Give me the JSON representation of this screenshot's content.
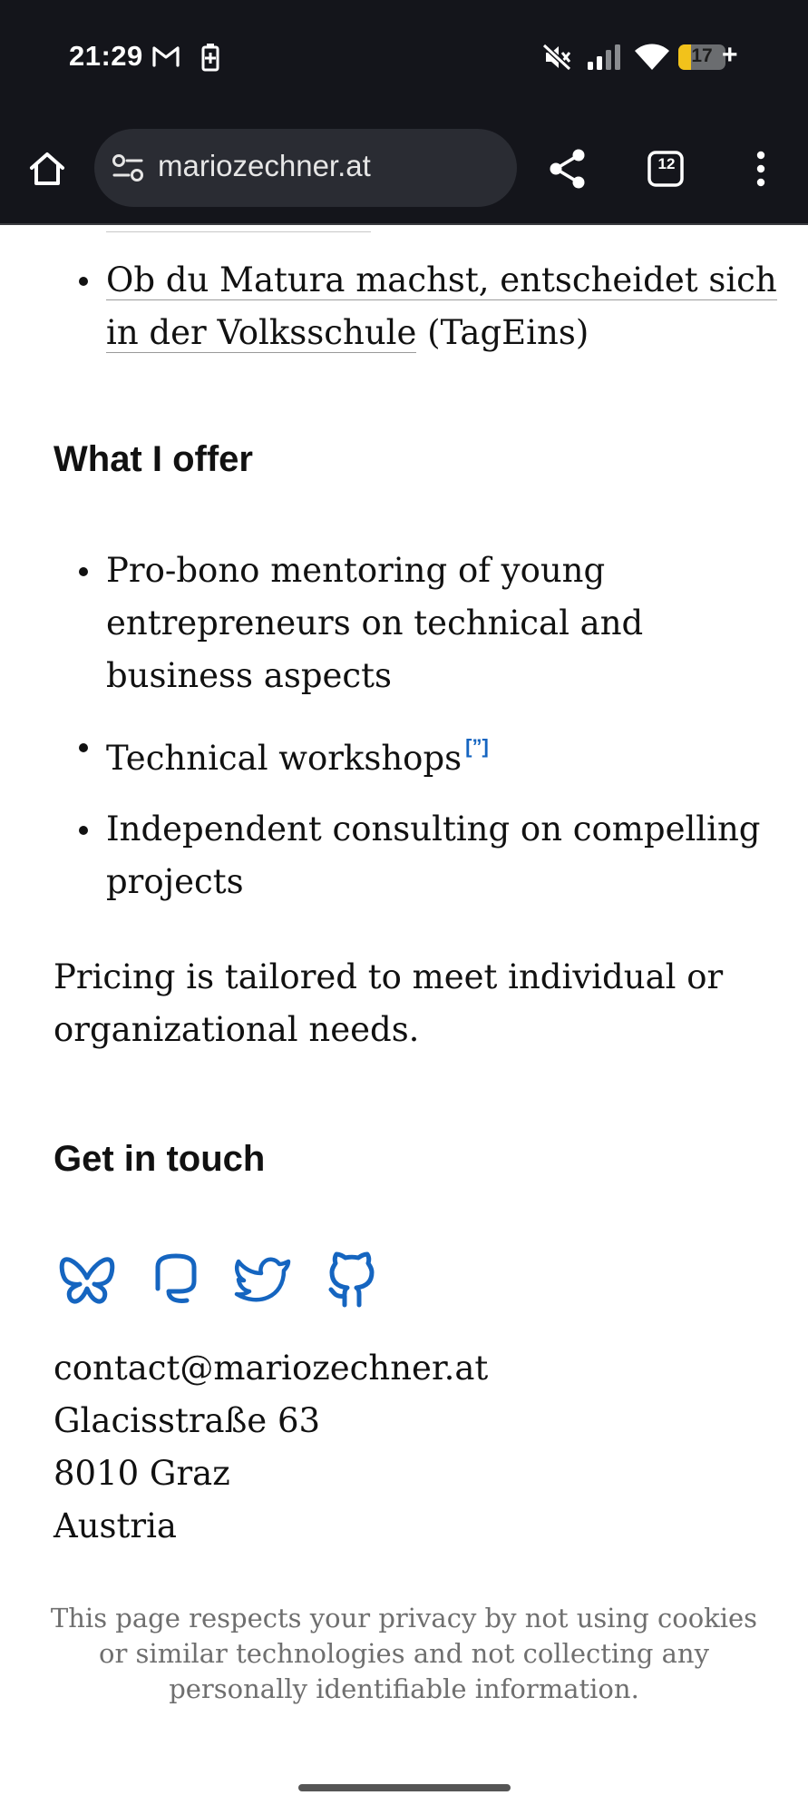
{
  "status_bar": {
    "time": "21:29",
    "notification_icons": [
      "gmail-icon",
      "battery-saver-icon"
    ],
    "system_icons": [
      "mute-icon",
      "signal-icon",
      "wifi-icon"
    ],
    "battery_level": "17",
    "battery_charging": "+"
  },
  "browser": {
    "url": "mariozechner.at",
    "tab_count": "12",
    "icons": [
      "home-icon",
      "site-settings-icon",
      "share-icon",
      "tabs-icon",
      "more-menu-icon"
    ]
  },
  "content": {
    "prev_list": {
      "link_text": "Ob du Matura machst, entscheidet sich in der Volksschule",
      "suffix": " (TagEins)"
    },
    "offer_heading": "What I offer",
    "offer_items": [
      "Pro-bono mentoring of young entrepreneurs on technical and business aspects",
      "Technical workshops",
      "Independent consulting on compelling projects"
    ],
    "workshop_link_label": "[”]",
    "pricing_text": "Pricing is tailored to meet individual or organizational needs.",
    "contact_heading": "Get in touch",
    "social_links": [
      "bluesky-icon",
      "mastodon-icon",
      "twitter-icon",
      "github-icon"
    ],
    "contact": {
      "email": "contact@mariozechner.at",
      "street": "Glacisstraße 63",
      "city": "8010 Graz",
      "country": "Austria"
    },
    "privacy_note": "This page respects your privacy by not using cookies or similar technologies and not collecting any personally identifiable information."
  },
  "colors": {
    "chrome_bg": "#14151b",
    "url_pill_bg": "#2a2c33",
    "link_blue": "#1565c0",
    "text": "#111111",
    "muted_text": "#6f6f6f"
  }
}
